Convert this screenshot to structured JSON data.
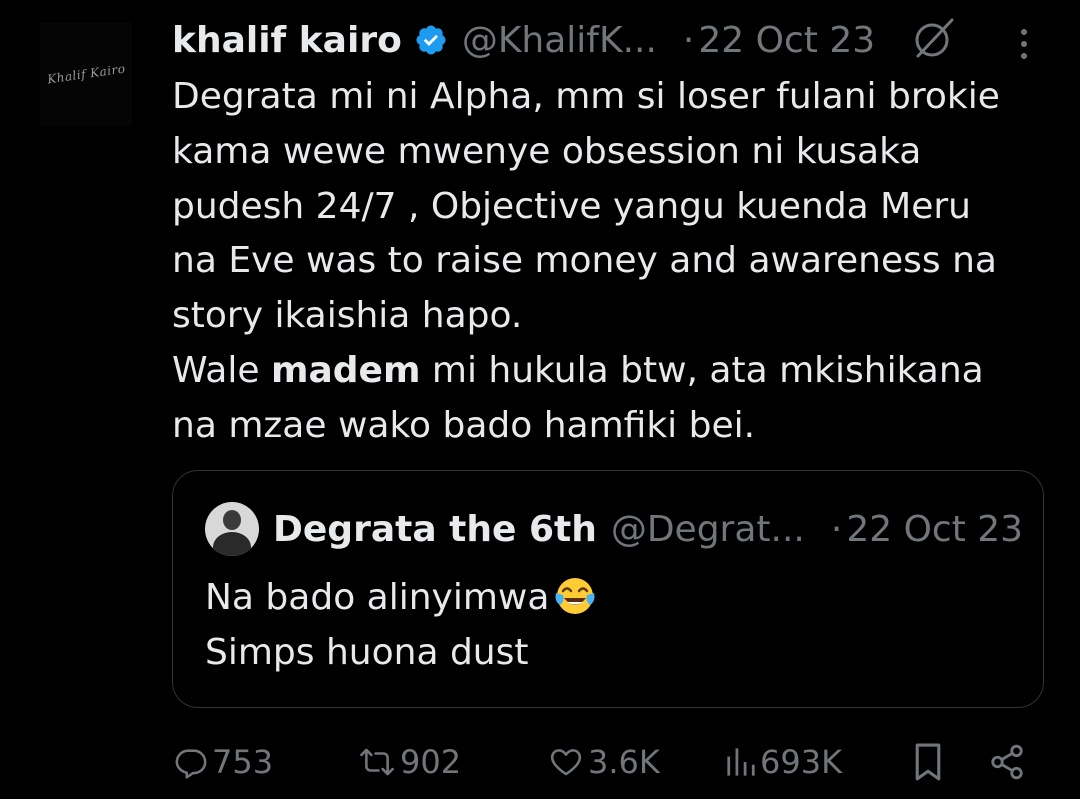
{
  "tweet": {
    "author": {
      "avatar_signature": "Khalif Kairo",
      "display_name": "khalif kairo",
      "handle": "@KhalifK...",
      "verified_icon": "verified-badge-icon"
    },
    "separator": "·",
    "date": "22 Oct 23",
    "text_lines": [
      "Degrata mi ni Alpha, mm  si loser fulani brokie",
      "kama wewe mwenye obsession ni kusaka",
      "pudesh 24/7 , Objective yangu kuenda Meru",
      "na Eve was to raise money and awareness na",
      "story ikaishia hapo."
    ],
    "text_line6": {
      "before": "Wale ",
      "bold": "madem",
      "after": " mi hukula btw, ata mkishikana"
    },
    "text_line7": "na mzae wako bado hamfiki bei.",
    "quote": {
      "display_name": "Degrata the 6th",
      "handle": "@Degrat...",
      "separator": "·",
      "date": "22 Oct 23",
      "line1": "Na bado alinyimwa",
      "line1_emoji": "face-with-tears-of-joy-icon",
      "line2": "Simps huona dust"
    },
    "actions": {
      "replies": "753",
      "reposts": "902",
      "likes": "3.6K",
      "views": "693K"
    }
  },
  "colors": {
    "background": "#000000",
    "text": "#e7e9ea",
    "secondary": "#71767b",
    "verified": "#1d9bf0",
    "border": "#2f3336"
  }
}
